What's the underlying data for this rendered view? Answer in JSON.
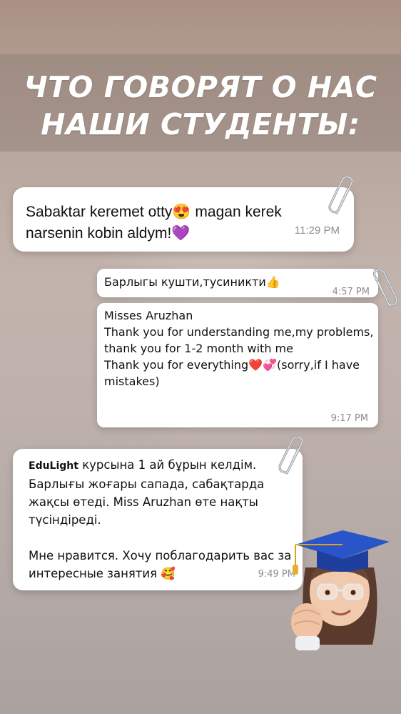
{
  "title": {
    "line1": "ЧТО ГОВОРЯТ О НАС",
    "line2": "НАШИ СТУДЕНТЫ:"
  },
  "reviews": [
    {
      "text": "Sabaktar keremet otty😍 magan kerek\nnarsenin kobin aldym!💜",
      "time": "11:29 PM"
    },
    {
      "text": "Барлыгы кушти,тусиникти👍",
      "time": "4:57 PM"
    },
    {
      "text": "Misses Aruzhan\nThank you for understanding me,my problems, thank you for 1-2 month with me\nThank you for everything❤️💞(sorry,if I have mistakes)",
      "time": "9:17 PM"
    },
    {
      "brand": "EduLight",
      "text": " курсына 1 ай бұрын келдім.\nБарлығы жоғары сапада, сабақтарда жақсы өтеді. Miss Aruzhan өте нақты түсіндіреді.\n\nМне нравится. Хочу поблагодарить вас за интересные занятия 🥰",
      "time": "9:49 PM"
    }
  ],
  "icons": {
    "attachment": "paperclip-icon",
    "avatar": "graduate-avatar"
  },
  "colors": {
    "bubble": "#ffffff",
    "time": "#8d8d92",
    "cap": "#2a55c8"
  }
}
